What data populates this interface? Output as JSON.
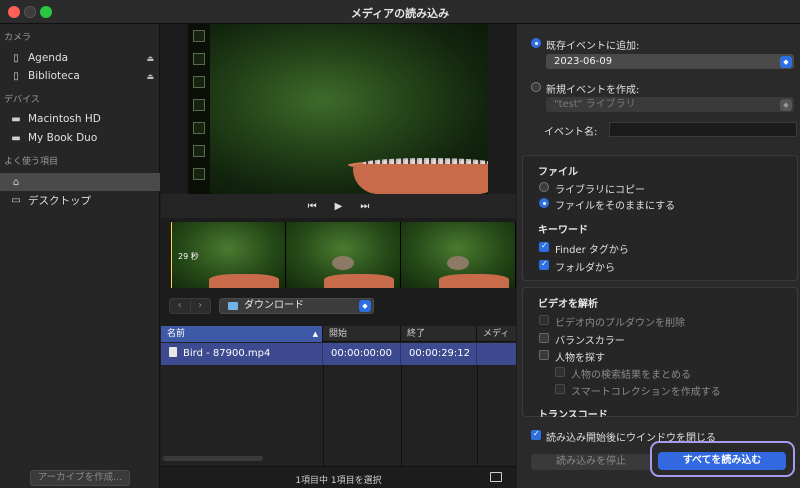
{
  "window": {
    "title": "メディアの読み込み"
  },
  "sidebar": {
    "sections": {
      "camera": "カメラ",
      "devices": "デバイス",
      "favorites": "よく使う項目"
    },
    "camera_items": [
      {
        "label": "Agenda",
        "icon": "phone-icon"
      },
      {
        "label": "Biblioteca",
        "icon": "phone-icon"
      }
    ],
    "device_items": [
      {
        "label": "Macintosh HD",
        "icon": "drive-icon"
      },
      {
        "label": "My Book Duo",
        "icon": "drive-icon"
      }
    ],
    "favorite_items": [
      {
        "label": "",
        "icon": "home-icon",
        "selected": true
      },
      {
        "label": "デスクトップ",
        "icon": "desktop-icon"
      }
    ],
    "archive_button": "アーカイブを作成..."
  },
  "viewer": {
    "duration": "29 秒"
  },
  "browser": {
    "folder": "ダウンロード",
    "columns": [
      "名前",
      "開始",
      "終了",
      "メディ"
    ],
    "rows": [
      {
        "name": "Bird - 87900.mp4",
        "start": "00:00:00:00",
        "end": "00:00:29:12"
      }
    ],
    "status": "1項目中 1項目を選択"
  },
  "options": {
    "add_existing_label": "既存イベントに追加:",
    "existing_event": "2023-06-09",
    "new_event_label": "新規イベントを作成:",
    "library": "\"test\" ライブラリ",
    "event_name_label": "イベント名:",
    "files_heading": "ファイル",
    "copy_to_library": "ライブラリにコピー",
    "leave_in_place": "ファイルをそのままにする",
    "keywords_heading": "キーワード",
    "from_finder_tags": "Finder タグから",
    "from_folders": "フォルダから",
    "analyze_heading": "ビデオを解析",
    "remove_pulldown": "ビデオ内のプルダウンを削除",
    "balance_color": "バランスカラー",
    "find_people": "人物を探す",
    "consolidate_people": "人物の検索結果をまとめる",
    "create_smart_collections": "スマートコレクションを作成する",
    "transcode_heading": "トランスコード",
    "close_window": "読み込み開始後にウインドウを閉じる",
    "stop_import": "読み込みを停止",
    "import_all": "すべてを読み込む"
  },
  "colors": {
    "accent": "#2d6fe0",
    "selection": "#3e4a8f",
    "highlight_ring": "#a59cf0"
  }
}
